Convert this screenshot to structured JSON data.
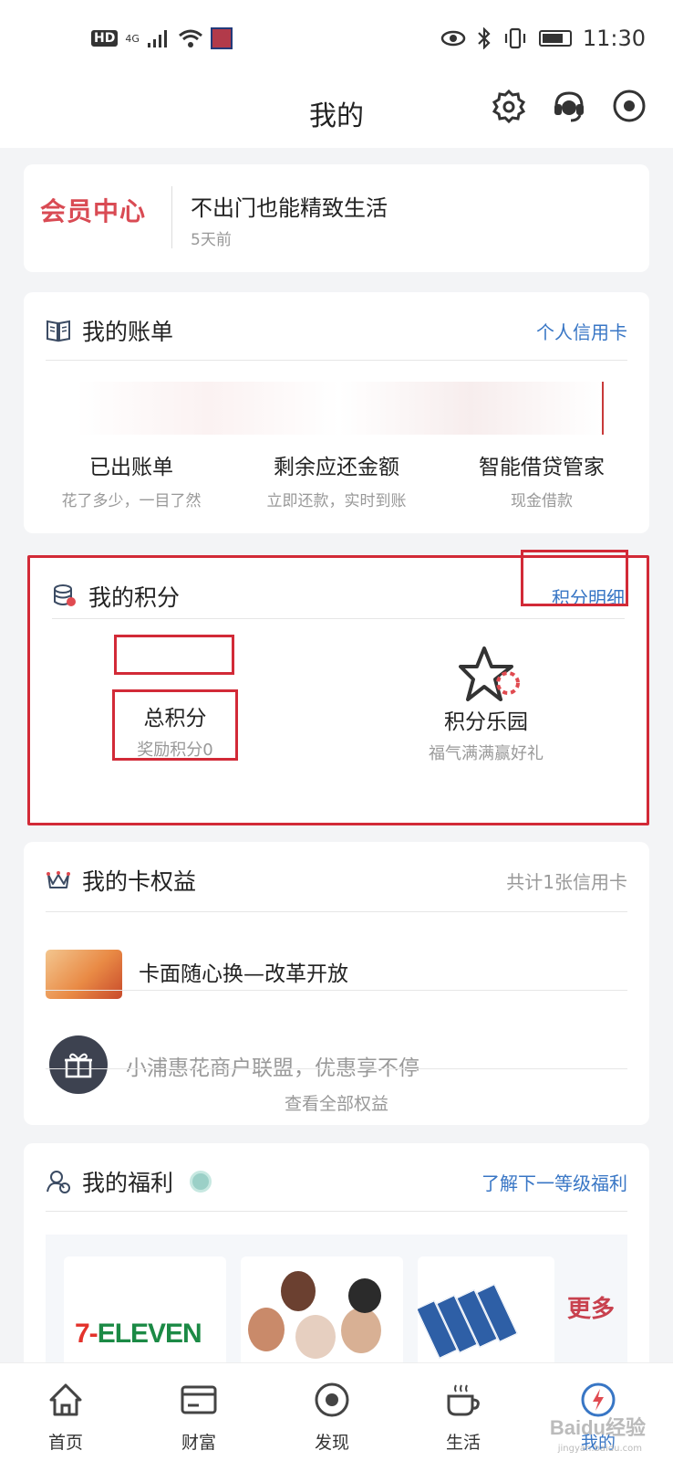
{
  "status": {
    "network": "4G",
    "hd": "HD",
    "time": "11:30"
  },
  "header": {
    "title": "我的"
  },
  "member": {
    "logo": "会员中心",
    "message": "不出门也能精致生活",
    "time": "5天前"
  },
  "bill": {
    "title": "我的账单",
    "link": "个人信用卡",
    "columns": [
      {
        "main": "已出账单",
        "sub": "花了多少，一目了然"
      },
      {
        "main": "剩余应还金额",
        "sub": "立即还款，实时到账"
      },
      {
        "main": "智能借贷管家",
        "sub": "现金借款"
      }
    ]
  },
  "points": {
    "title": "我的积分",
    "link": "积分明细",
    "total_label": "总积分",
    "reward": "奖励积分0",
    "park_label": "积分乐园",
    "park_sub": "福气满满赢好礼"
  },
  "rights": {
    "title": "我的卡权益",
    "count": "共计1张信用卡",
    "item1": "卡面随心换—改革开放",
    "item2": "小浦惠花商户联盟，优惠享不停",
    "view_all": "查看全部权益"
  },
  "welfare": {
    "title": "我的福利",
    "link": "了解下一等级福利",
    "brand": "ELEVEN",
    "brand_prefix": "7-",
    "more": "更多"
  },
  "tabs": [
    {
      "label": "首页"
    },
    {
      "label": "财富"
    },
    {
      "label": "发现"
    },
    {
      "label": "生活"
    },
    {
      "label": "我的"
    }
  ],
  "watermark": {
    "main": "Baidu经验",
    "sub": "jingyan.baidu.com"
  },
  "colors": {
    "accent": "#3876c5",
    "highlight_box": "#d22a37"
  }
}
